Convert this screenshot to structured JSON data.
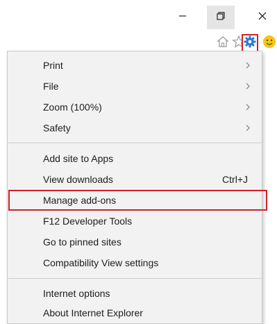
{
  "window_controls": {
    "minimize_icon": "minimize-icon",
    "restore_icon": "restore-icon",
    "close_icon": "close-icon"
  },
  "command_bar": {
    "icons": [
      "home-icon",
      "star-icon",
      "gear-icon",
      "smiley-icon"
    ],
    "accent": "#d0202a",
    "gear_color": "#2b7bd1"
  },
  "menu": {
    "groups": [
      {
        "items": [
          {
            "label": "Print",
            "submenu": true
          },
          {
            "label": "File",
            "submenu": true
          },
          {
            "label": "Zoom (100%)",
            "submenu": true
          },
          {
            "label": "Safety",
            "submenu": true
          }
        ]
      },
      {
        "items": [
          {
            "label": "Add site to Apps"
          },
          {
            "label": "View downloads",
            "shortcut": "Ctrl+J"
          },
          {
            "label": "Manage add-ons",
            "highlighted": true
          },
          {
            "label": "F12 Developer Tools"
          },
          {
            "label": "Go to pinned sites"
          },
          {
            "label": "Compatibility View settings"
          }
        ]
      },
      {
        "items": [
          {
            "label": "Internet options"
          },
          {
            "label": "About Internet Explorer"
          }
        ]
      }
    ]
  }
}
